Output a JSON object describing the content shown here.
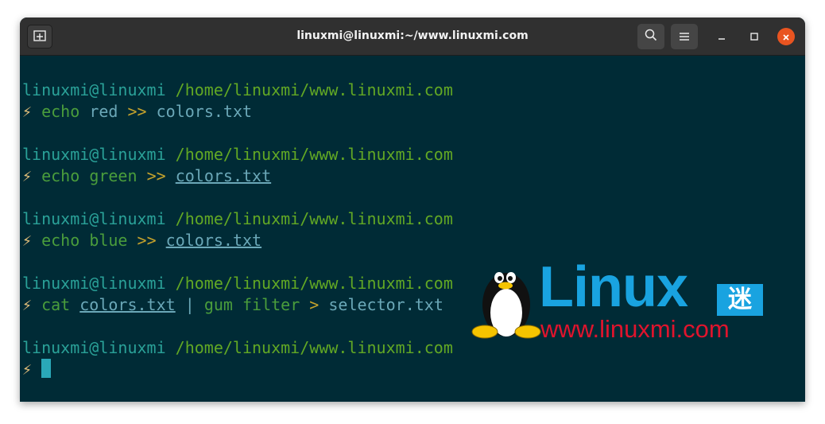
{
  "window": {
    "title": "linuxmi@linuxmi:~/www.linuxmi.com"
  },
  "colors": {
    "terminal_bg": "#002b36",
    "titlebar_bg": "#303030",
    "close_button": "#e95420",
    "logo_blue": "#19a3e0",
    "logo_red": "#e0142d"
  },
  "icons": {
    "new_tab": "new-tab-icon",
    "search": "search-icon",
    "menu": "hamburger-menu-icon",
    "minimize": "minimize-icon",
    "maximize": "maximize-icon",
    "close": "close-icon",
    "prompt": "lightning-bolt-icon"
  },
  "terminal": {
    "prompt_user": "linuxmi@linuxmi",
    "prompt_path": "/home/linuxmi/www.linuxmi.com",
    "prompt_symbol": "⚡",
    "commands": [
      {
        "cmd": "echo",
        "arg": "red",
        "op": ">>",
        "file": "colors.txt"
      },
      {
        "cmd": "echo",
        "arg": "green",
        "op": ">>",
        "file": "colors.txt"
      },
      {
        "cmd": "echo",
        "arg": "blue",
        "op": ">>",
        "file": "colors.txt"
      },
      {
        "cmd": "cat",
        "file": "colors.txt",
        "pipe": "|",
        "cmd2": "gum filter",
        "op": ">",
        "out": "selector.txt"
      }
    ]
  },
  "watermark": {
    "word": "Linux",
    "badge": "迷",
    "url": "www.linuxmi.com"
  }
}
